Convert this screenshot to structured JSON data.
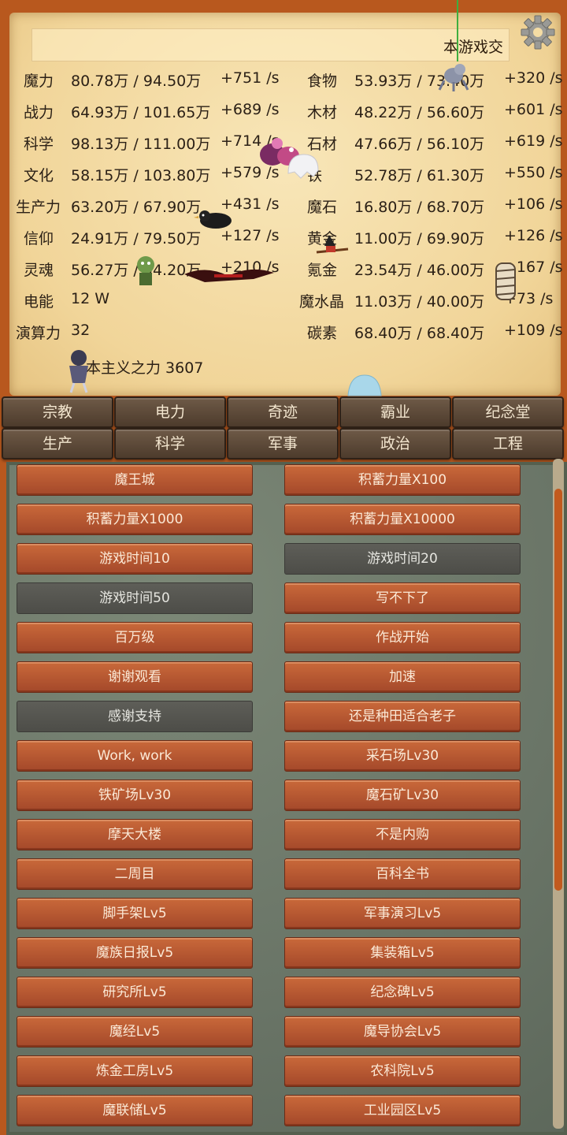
{
  "marquee": "本游戏交",
  "resources_left": [
    {
      "name": "魔力",
      "value": "80.78万 / 94.50万",
      "rate": "+751 /s"
    },
    {
      "name": "战力",
      "value": "64.93万 / 101.65万",
      "rate": "+689 /s"
    },
    {
      "name": "科学",
      "value": "98.13万 / 111.00万",
      "rate": "+714 /s"
    },
    {
      "name": "文化",
      "value": "58.15万 / 103.80万",
      "rate": "+579 /s"
    },
    {
      "name": "生产力",
      "value": "63.20万 / 67.90万",
      "rate": "+431 /s"
    },
    {
      "name": "信仰",
      "value": "24.91万 / 79.50万",
      "rate": "+127 /s"
    },
    {
      "name": "灵魂",
      "value": "56.27万 / 94.20万",
      "rate": "+210 /s"
    },
    {
      "name": "电能",
      "value": "12 W",
      "rate": ""
    },
    {
      "name": "演算力",
      "value": "32",
      "rate": ""
    }
  ],
  "resources_right": [
    {
      "name": "食物",
      "value": "53.93万 / 73.40万",
      "rate": "+320 /s"
    },
    {
      "name": "木材",
      "value": "48.22万 / 56.60万",
      "rate": "+601 /s"
    },
    {
      "name": "石材",
      "value": "47.66万 / 56.10万",
      "rate": "+619 /s"
    },
    {
      "name": "铁",
      "value": "52.78万 / 61.30万",
      "rate": "+550 /s"
    },
    {
      "name": "魔石",
      "value": "16.80万 / 68.70万",
      "rate": "+106 /s"
    },
    {
      "name": "黄金",
      "value": "11.00万 / 69.90万",
      "rate": "+126 /s"
    },
    {
      "name": "氪金",
      "value": "23.54万 / 46.00万",
      "rate": "+167 /s"
    },
    {
      "name": "魔水晶",
      "value": "11.03万 / 40.00万",
      "rate": "+73 /s"
    },
    {
      "name": "碳素",
      "value": "68.40万 / 68.40万",
      "rate": "+109 /s"
    }
  ],
  "humanism": "人本主义之力 3607",
  "tabs_row1": [
    "宗教",
    "电力",
    "奇迹",
    "霸业",
    "纪念堂"
  ],
  "tabs_row2": [
    "生产",
    "科学",
    "军事",
    "政治",
    "工程"
  ],
  "achievements": [
    {
      "label": "魔王城",
      "unlocked": true
    },
    {
      "label": "积蓄力量X100",
      "unlocked": true
    },
    {
      "label": "积蓄力量X1000",
      "unlocked": true
    },
    {
      "label": "积蓄力量X10000",
      "unlocked": true
    },
    {
      "label": "游戏时间10",
      "unlocked": true
    },
    {
      "label": "游戏时间20",
      "unlocked": false
    },
    {
      "label": "游戏时间50",
      "unlocked": false
    },
    {
      "label": "写不下了",
      "unlocked": true
    },
    {
      "label": "百万级",
      "unlocked": true
    },
    {
      "label": "作战开始",
      "unlocked": true
    },
    {
      "label": "谢谢观看",
      "unlocked": true
    },
    {
      "label": "加速",
      "unlocked": true
    },
    {
      "label": "感谢支持",
      "unlocked": false
    },
    {
      "label": "还是种田适合老子",
      "unlocked": true
    },
    {
      "label": "Work, work",
      "unlocked": true
    },
    {
      "label": "采石场Lv30",
      "unlocked": true
    },
    {
      "label": "铁矿场Lv30",
      "unlocked": true
    },
    {
      "label": "魔石矿Lv30",
      "unlocked": true
    },
    {
      "label": "摩天大楼",
      "unlocked": true
    },
    {
      "label": "不是内购",
      "unlocked": true
    },
    {
      "label": "二周目",
      "unlocked": true
    },
    {
      "label": "百科全书",
      "unlocked": true
    },
    {
      "label": "脚手架Lv5",
      "unlocked": true
    },
    {
      "label": "军事演习Lv5",
      "unlocked": true
    },
    {
      "label": "魔族日报Lv5",
      "unlocked": true
    },
    {
      "label": "集装箱Lv5",
      "unlocked": true
    },
    {
      "label": "研究所Lv5",
      "unlocked": true
    },
    {
      "label": "纪念碑Lv5",
      "unlocked": true
    },
    {
      "label": "魔经Lv5",
      "unlocked": true
    },
    {
      "label": "魔导协会Lv5",
      "unlocked": true
    },
    {
      "label": "炼金工房Lv5",
      "unlocked": true
    },
    {
      "label": "农科院Lv5",
      "unlocked": true
    },
    {
      "label": "魔联储Lv5",
      "unlocked": true
    },
    {
      "label": "工业园区Lv5",
      "unlocked": true
    }
  ],
  "scroll_position": 0.05
}
